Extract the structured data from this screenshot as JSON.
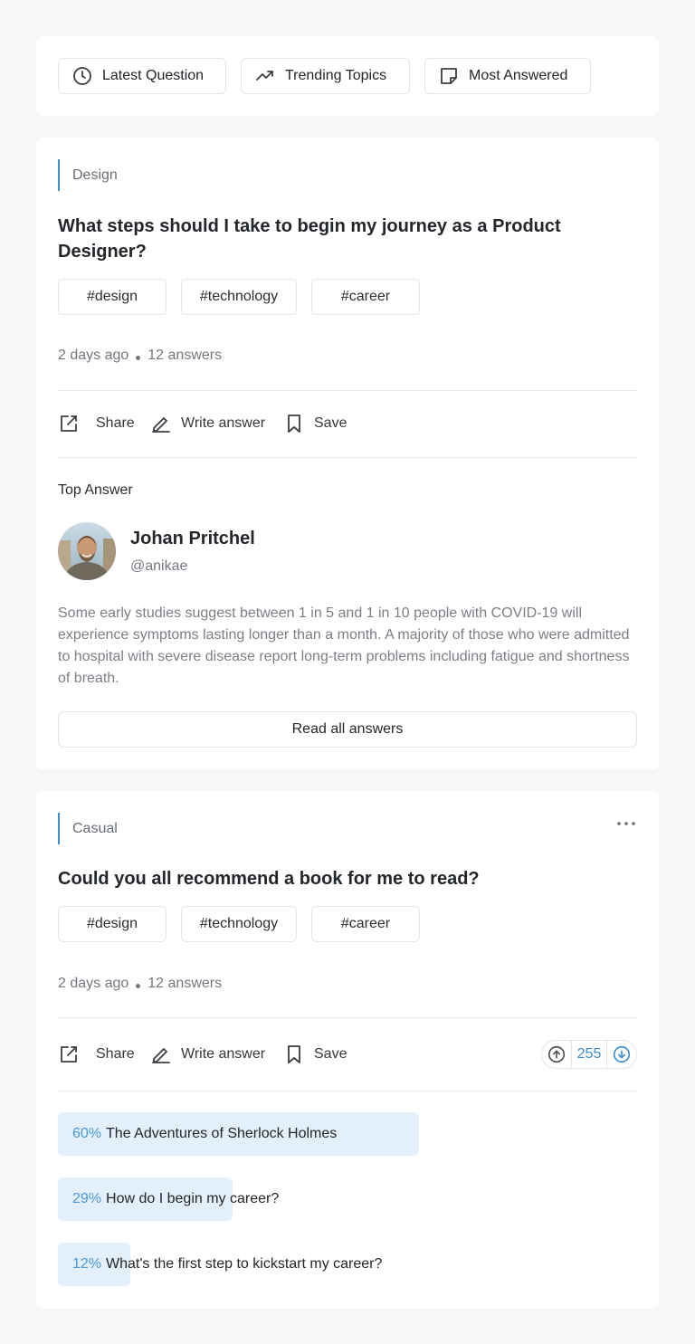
{
  "filters": [
    {
      "label": "Latest Question",
      "icon": "clock-icon"
    },
    {
      "label": "Trending Topics",
      "icon": "trending-icon"
    },
    {
      "label": "Most Answered",
      "icon": "note-icon"
    }
  ],
  "questions": [
    {
      "category": "Design",
      "title": "What steps should I take to begin my journey as a Product Designer?",
      "tags": [
        "#design",
        "#technology",
        "#career"
      ],
      "time": "2 days ago",
      "answers_count": "12 answers",
      "actions": {
        "share": "Share",
        "write": "Write answer",
        "save": "Save"
      },
      "top_answer": {
        "label": "Top Answer",
        "author_name": "Johan Pritchel",
        "author_handle": "@anikae",
        "text": "Some early studies suggest between 1 in 5 and 1 in 10 people with COVID-19 will experience symptoms lasting longer than a month. A majority of those who were admitted to hospital with severe disease report long-term problems including fatigue and shortness of breath.",
        "read_all": "Read all answers"
      }
    },
    {
      "category": "Casual",
      "title": "Could you all recommend a book for me to read?",
      "tags": [
        "#design",
        "#technology",
        "#career"
      ],
      "time": "2 days ago",
      "answers_count": "12 answers",
      "actions": {
        "share": "Share",
        "write": "Write answer",
        "save": "Save"
      },
      "votes": "255",
      "poll": [
        {
          "percent": "60%",
          "fraction": 0.6,
          "label": "The Adventures of Sherlock Holmes"
        },
        {
          "percent": "29%",
          "fraction": 0.29,
          "label": "How do I begin my career?"
        },
        {
          "percent": "12%",
          "fraction": 0.12,
          "label": "What's the first step to kickstart my career?"
        }
      ]
    }
  ],
  "colors": {
    "accent": "#3b8fd0",
    "poll_fill": "#e3f0fb"
  }
}
